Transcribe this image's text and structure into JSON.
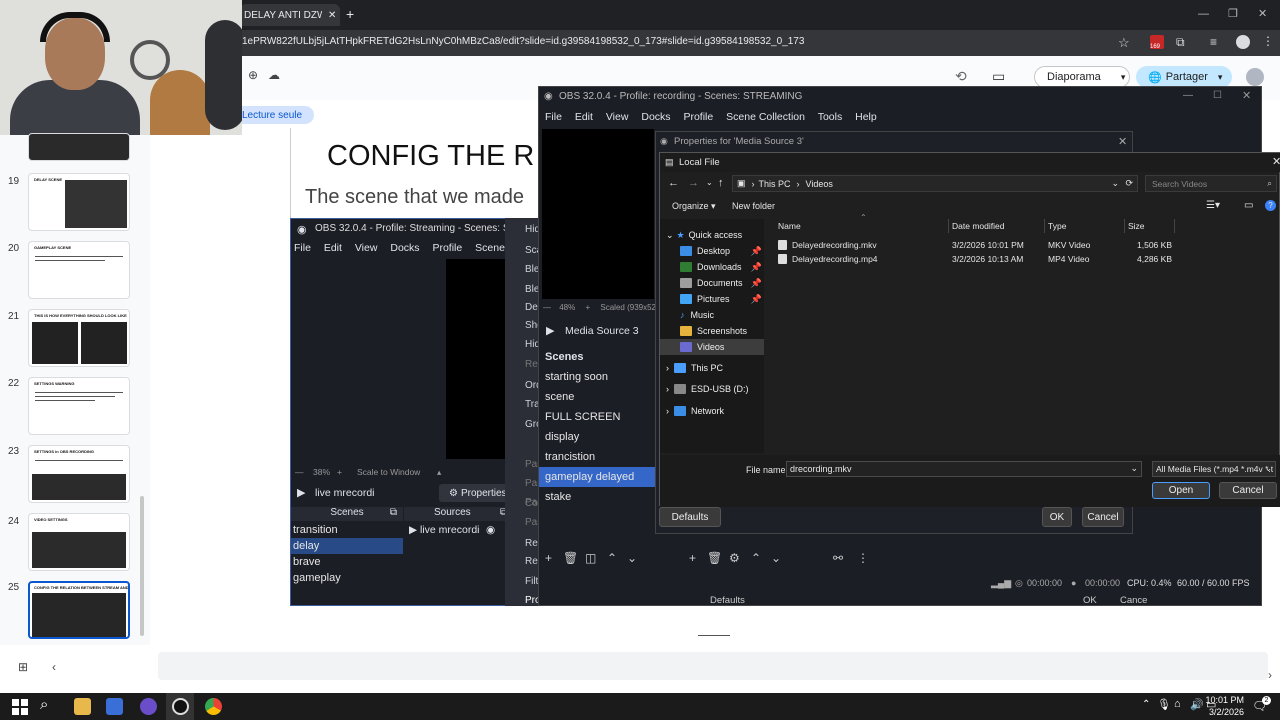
{
  "browser": {
    "tab_title": "DELAY ANTI DZWAM",
    "new_tab": "+",
    "url": "1ePRW822fULbj5jLAtTHpkFRETdG2HsLnNyC0hMBzCa8/edit?slide=id.g39584198532_0_173#slide=id.g39584198532_0_173",
    "ext_badge": "169"
  },
  "slides_app": {
    "diaporama_label": "Diaporama",
    "share_label": "Partager",
    "readonly_label": "Lecture seule",
    "slide_title": "CONFIG THE R",
    "slide_subtitle": "The scene that we made",
    "thumbnails": [
      {
        "num": "19",
        "title": "DELAY SCENE"
      },
      {
        "num": "20",
        "title": "GAMEPLAY SCENE"
      },
      {
        "num": "21",
        "title": "THIS IS HOW EVERYTHING SHOULD LOOK LIKE"
      },
      {
        "num": "22",
        "title": "SETTINGS WARNING"
      },
      {
        "num": "23",
        "title": "SETTINGS in OBS RECORDING"
      },
      {
        "num": "24",
        "title": "VIDEO SETTINGS"
      },
      {
        "num": "25",
        "title": "CONFIG THE RELATION BETWEEN STREAM AND REC"
      }
    ]
  },
  "obs_inner": {
    "title": "OBS 32.0.4 - Profile: Streaming - Scenes: Streaming",
    "menu": [
      "File",
      "Edit",
      "View",
      "Docks",
      "Profile",
      "Scene Collection"
    ],
    "zoom": "38%",
    "scale_label": "Scale to Window",
    "source_name": "live mrecordi",
    "properties_btn": "Properties",
    "scenes_header": "Scenes",
    "sources_header": "Sources",
    "scenes": [
      "transition",
      "delay",
      "brave",
      "gameplay"
    ],
    "sources": [
      "live mrecordi"
    ]
  },
  "context_menu": {
    "items": [
      "Hid",
      "Sca",
      "Ble",
      "Ble",
      "Dei",
      "Sho",
      "Hid",
      "Res",
      "Ord",
      "Tra",
      "Gro",
      "Pas",
      "Pas",
      "Pas",
      "Cop",
      "Pas",
      "Ren",
      "Ren",
      "Filt",
      "Properties"
    ]
  },
  "obs_outer": {
    "title": "OBS 32.0.4 - Profile: recording - Scenes: STREAMING",
    "menu": [
      "File",
      "Edit",
      "View",
      "Docks",
      "Profile",
      "Scene Collection",
      "Tools",
      "Help"
    ],
    "zoom": "48%",
    "scaled_label": "Scaled (939x52",
    "source_name": "Media Source 3",
    "scenes_header": "Scenes",
    "scenes": [
      "starting soon",
      "scene",
      "FULL SCREEN",
      "display",
      "trancistion",
      "gameplay delayed",
      "stake"
    ],
    "selected_scene": "gameplay delayed",
    "status_time1": "00:00:00",
    "status_time2": "00:00:00",
    "cpu": "CPU: 0.4%",
    "fps": "60.00 / 60.00 FPS",
    "bottom_defaults": "Defaults",
    "bottom_ok": "OK",
    "bottom_cancel": "Cance"
  },
  "properties_dialog": {
    "title": "Properties for 'Media Source 3'",
    "defaults": "Defaults",
    "ok": "OK",
    "cancel": "Cancel"
  },
  "file_dialog": {
    "title": "Local File",
    "breadcrumb": [
      "This PC",
      "Videos"
    ],
    "search_placeholder": "Search Videos",
    "organize": "Organize",
    "new_folder": "New folder",
    "columns": {
      "name": "Name",
      "date": "Date modified",
      "type": "Type",
      "size": "Size"
    },
    "files": [
      {
        "name": "Delayedrecording.mkv",
        "date": "3/2/2026 10:01 PM",
        "type": "MKV Video",
        "size": "1,506 KB"
      },
      {
        "name": "Delayedrecording.mp4",
        "date": "3/2/2026 10:13 AM",
        "type": "MP4 Video",
        "size": "4,286 KB"
      }
    ],
    "nav": [
      {
        "label": "Quick access",
        "icon": "star"
      },
      {
        "label": "Desktop",
        "icon": "desktop",
        "pin": true
      },
      {
        "label": "Downloads",
        "icon": "download",
        "pin": true
      },
      {
        "label": "Documents",
        "icon": "document",
        "pin": true
      },
      {
        "label": "Pictures",
        "icon": "picture",
        "pin": true
      },
      {
        "label": "Music",
        "icon": "music"
      },
      {
        "label": "Screenshots",
        "icon": "folder"
      },
      {
        "label": "Videos",
        "icon": "video"
      },
      {
        "label": "This PC",
        "icon": "pc"
      },
      {
        "label": "ESD-USB (D:)",
        "icon": "usb"
      },
      {
        "label": "Network",
        "icon": "network"
      }
    ],
    "filename_label": "File name:",
    "filename_value": "drecording.mkv",
    "filter_value": "All Media Files (*.mp4 *.m4v *.t",
    "open": "Open",
    "cancel": "Cancel"
  },
  "taskbar": {
    "time": "10:01 PM",
    "date": "3/2/2026",
    "notif": "2"
  },
  "colors": {
    "obs_bg": "#1c1e26",
    "selection": "#3567c9",
    "slides_accent": "#c2e7ff"
  }
}
